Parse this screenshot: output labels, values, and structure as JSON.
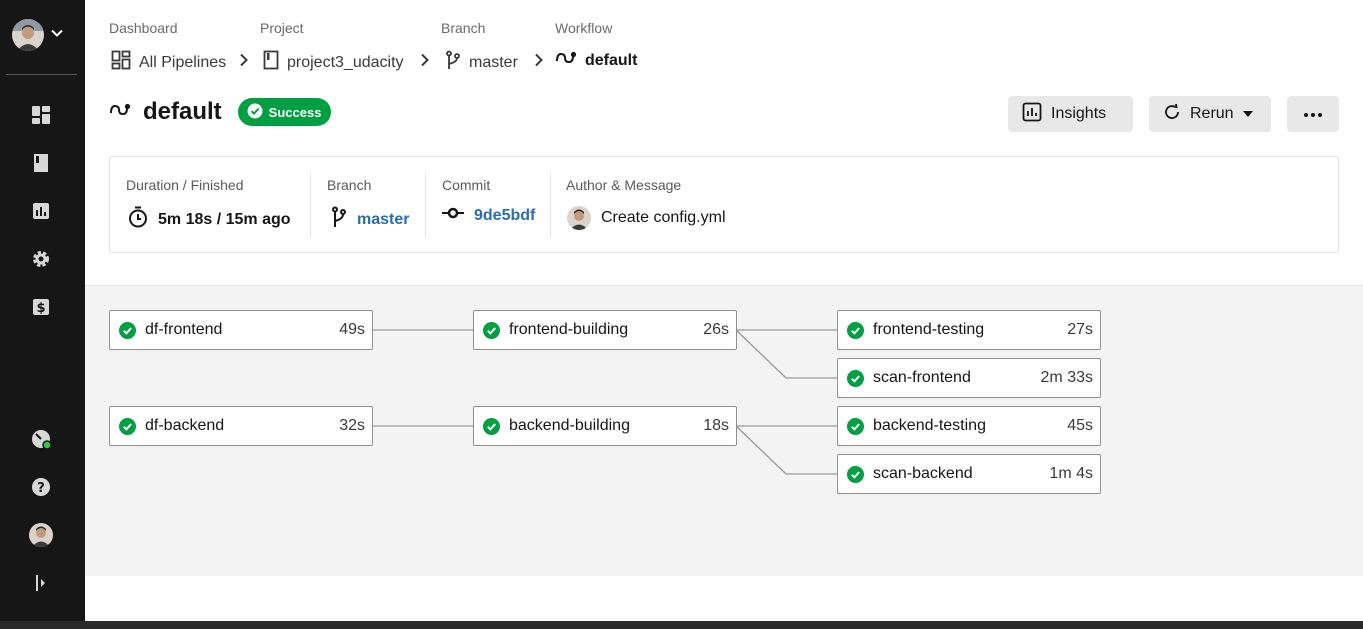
{
  "sidebar": {
    "items": [
      {
        "icon": "dashboard-icon"
      },
      {
        "icon": "projects-icon"
      },
      {
        "icon": "insights-icon"
      },
      {
        "icon": "settings-gear-icon"
      },
      {
        "icon": "plans-dollar-icon"
      },
      {
        "icon": "status-gauge-icon"
      },
      {
        "icon": "help-icon"
      },
      {
        "icon": "user-avatar"
      },
      {
        "icon": "expand-sidebar-icon"
      }
    ]
  },
  "breadcrumb": {
    "dashboard": {
      "label": "Dashboard",
      "value": "All Pipelines"
    },
    "project": {
      "label": "Project",
      "value": "project3_udacity"
    },
    "branch": {
      "label": "Branch",
      "value": "master"
    },
    "workflow": {
      "label": "Workflow",
      "value": "default"
    }
  },
  "header": {
    "title": "default",
    "status": "Success",
    "insights_label": "Insights",
    "rerun_label": "Rerun"
  },
  "info": {
    "duration": {
      "label": "Duration / Finished",
      "value": "5m 18s / 15m ago"
    },
    "branch": {
      "label": "Branch",
      "value": "master"
    },
    "commit": {
      "label": "Commit",
      "value": "9de5bdf"
    },
    "author": {
      "label": "Author & Message",
      "value": "Create config.yml"
    }
  },
  "jobs": [
    {
      "name": "df-frontend",
      "duration": "49s",
      "status": "success"
    },
    {
      "name": "frontend-building",
      "duration": "26s",
      "status": "success"
    },
    {
      "name": "frontend-testing",
      "duration": "27s",
      "status": "success"
    },
    {
      "name": "scan-frontend",
      "duration": "2m 33s",
      "status": "success"
    },
    {
      "name": "df-backend",
      "duration": "32s",
      "status": "success"
    },
    {
      "name": "backend-building",
      "duration": "18s",
      "status": "success"
    },
    {
      "name": "backend-testing",
      "duration": "45s",
      "status": "success"
    },
    {
      "name": "scan-backend",
      "duration": "1m 4s",
      "status": "success"
    }
  ],
  "colors": {
    "sidebar_bg": "#161616",
    "success_green": "#009f42",
    "link_blue": "#2b6cb0",
    "graph_bg": "#f3f3f3"
  }
}
